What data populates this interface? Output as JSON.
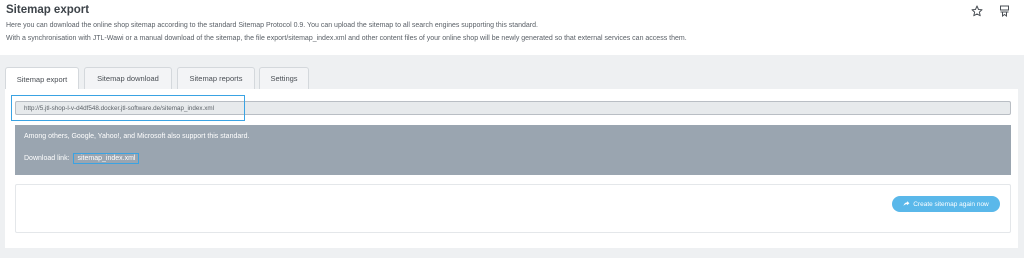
{
  "page": {
    "title": "Sitemap export",
    "description_line1": "Here you can download the online shop sitemap according to the standard Sitemap Protocol 0.9. You can upload the sitemap to all search engines supporting this standard.",
    "description_line2": "With a synchronisation with JTL-Wawi or a manual download of the sitemap, the file export/sitemap_index.xml and other content files of your online shop will be newly generated so that external services can access them."
  },
  "header_icons": [
    "star-icon",
    "bookmark-icon"
  ],
  "tabs": [
    {
      "label": "Sitemap export",
      "active": true
    },
    {
      "label": "Sitemap download",
      "active": false
    },
    {
      "label": "Sitemap reports",
      "active": false
    },
    {
      "label": "Settings",
      "active": false
    }
  ],
  "sitemap": {
    "url": "http://5.jtl-shop-l-v-d4df548.docker.jtl-software.de/sitemap_index.xml",
    "info_text": "Among others, Google, Yahoo!, and Microsoft also support this standard.",
    "download_label": "Download link:",
    "download_link": "sitemap_index.xml"
  },
  "actions": {
    "create_button": "Create sitemap again now",
    "create_icon": "share-icon"
  },
  "colors": {
    "accent": "#3aa3e3",
    "button": "#5ab8ea",
    "info_box": "#9aa5b0"
  }
}
